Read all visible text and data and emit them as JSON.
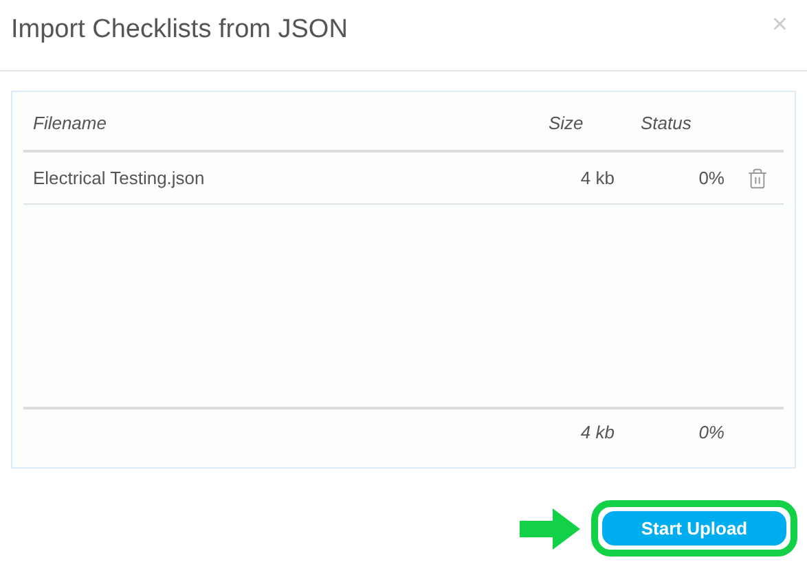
{
  "dialog": {
    "title": "Import Checklists from JSON",
    "close": "×"
  },
  "table": {
    "columns": [
      "Filename",
      "Size",
      "Status"
    ],
    "rows": [
      {
        "filename": "Electrical Testing.json",
        "size": "4 kb",
        "status": "0%"
      }
    ],
    "footer": {
      "size": "4 kb",
      "status": "0%"
    }
  },
  "button": {
    "label": "Start Upload"
  }
}
